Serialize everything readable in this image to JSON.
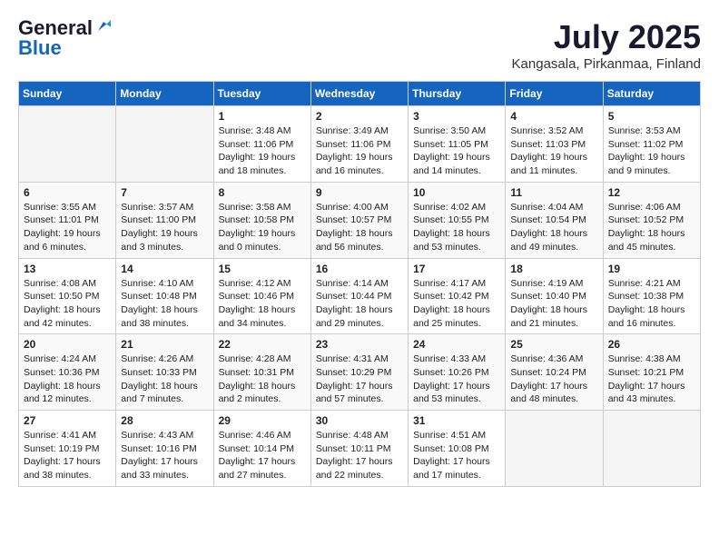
{
  "header": {
    "logo_general": "General",
    "logo_blue": "Blue",
    "month_year": "July 2025",
    "location": "Kangasala, Pirkanmaa, Finland"
  },
  "days_of_week": [
    "Sunday",
    "Monday",
    "Tuesday",
    "Wednesday",
    "Thursday",
    "Friday",
    "Saturday"
  ],
  "weeks": [
    [
      {
        "day": "",
        "info": ""
      },
      {
        "day": "",
        "info": ""
      },
      {
        "day": "1",
        "info": "Sunrise: 3:48 AM\nSunset: 11:06 PM\nDaylight: 19 hours\nand 18 minutes."
      },
      {
        "day": "2",
        "info": "Sunrise: 3:49 AM\nSunset: 11:06 PM\nDaylight: 19 hours\nand 16 minutes."
      },
      {
        "day": "3",
        "info": "Sunrise: 3:50 AM\nSunset: 11:05 PM\nDaylight: 19 hours\nand 14 minutes."
      },
      {
        "day": "4",
        "info": "Sunrise: 3:52 AM\nSunset: 11:03 PM\nDaylight: 19 hours\nand 11 minutes."
      },
      {
        "day": "5",
        "info": "Sunrise: 3:53 AM\nSunset: 11:02 PM\nDaylight: 19 hours\nand 9 minutes."
      }
    ],
    [
      {
        "day": "6",
        "info": "Sunrise: 3:55 AM\nSunset: 11:01 PM\nDaylight: 19 hours\nand 6 minutes."
      },
      {
        "day": "7",
        "info": "Sunrise: 3:57 AM\nSunset: 11:00 PM\nDaylight: 19 hours\nand 3 minutes."
      },
      {
        "day": "8",
        "info": "Sunrise: 3:58 AM\nSunset: 10:58 PM\nDaylight: 19 hours\nand 0 minutes."
      },
      {
        "day": "9",
        "info": "Sunrise: 4:00 AM\nSunset: 10:57 PM\nDaylight: 18 hours\nand 56 minutes."
      },
      {
        "day": "10",
        "info": "Sunrise: 4:02 AM\nSunset: 10:55 PM\nDaylight: 18 hours\nand 53 minutes."
      },
      {
        "day": "11",
        "info": "Sunrise: 4:04 AM\nSunset: 10:54 PM\nDaylight: 18 hours\nand 49 minutes."
      },
      {
        "day": "12",
        "info": "Sunrise: 4:06 AM\nSunset: 10:52 PM\nDaylight: 18 hours\nand 45 minutes."
      }
    ],
    [
      {
        "day": "13",
        "info": "Sunrise: 4:08 AM\nSunset: 10:50 PM\nDaylight: 18 hours\nand 42 minutes."
      },
      {
        "day": "14",
        "info": "Sunrise: 4:10 AM\nSunset: 10:48 PM\nDaylight: 18 hours\nand 38 minutes."
      },
      {
        "day": "15",
        "info": "Sunrise: 4:12 AM\nSunset: 10:46 PM\nDaylight: 18 hours\nand 34 minutes."
      },
      {
        "day": "16",
        "info": "Sunrise: 4:14 AM\nSunset: 10:44 PM\nDaylight: 18 hours\nand 29 minutes."
      },
      {
        "day": "17",
        "info": "Sunrise: 4:17 AM\nSunset: 10:42 PM\nDaylight: 18 hours\nand 25 minutes."
      },
      {
        "day": "18",
        "info": "Sunrise: 4:19 AM\nSunset: 10:40 PM\nDaylight: 18 hours\nand 21 minutes."
      },
      {
        "day": "19",
        "info": "Sunrise: 4:21 AM\nSunset: 10:38 PM\nDaylight: 18 hours\nand 16 minutes."
      }
    ],
    [
      {
        "day": "20",
        "info": "Sunrise: 4:24 AM\nSunset: 10:36 PM\nDaylight: 18 hours\nand 12 minutes."
      },
      {
        "day": "21",
        "info": "Sunrise: 4:26 AM\nSunset: 10:33 PM\nDaylight: 18 hours\nand 7 minutes."
      },
      {
        "day": "22",
        "info": "Sunrise: 4:28 AM\nSunset: 10:31 PM\nDaylight: 18 hours\nand 2 minutes."
      },
      {
        "day": "23",
        "info": "Sunrise: 4:31 AM\nSunset: 10:29 PM\nDaylight: 17 hours\nand 57 minutes."
      },
      {
        "day": "24",
        "info": "Sunrise: 4:33 AM\nSunset: 10:26 PM\nDaylight: 17 hours\nand 53 minutes."
      },
      {
        "day": "25",
        "info": "Sunrise: 4:36 AM\nSunset: 10:24 PM\nDaylight: 17 hours\nand 48 minutes."
      },
      {
        "day": "26",
        "info": "Sunrise: 4:38 AM\nSunset: 10:21 PM\nDaylight: 17 hours\nand 43 minutes."
      }
    ],
    [
      {
        "day": "27",
        "info": "Sunrise: 4:41 AM\nSunset: 10:19 PM\nDaylight: 17 hours\nand 38 minutes."
      },
      {
        "day": "28",
        "info": "Sunrise: 4:43 AM\nSunset: 10:16 PM\nDaylight: 17 hours\nand 33 minutes."
      },
      {
        "day": "29",
        "info": "Sunrise: 4:46 AM\nSunset: 10:14 PM\nDaylight: 17 hours\nand 27 minutes."
      },
      {
        "day": "30",
        "info": "Sunrise: 4:48 AM\nSunset: 10:11 PM\nDaylight: 17 hours\nand 22 minutes."
      },
      {
        "day": "31",
        "info": "Sunrise: 4:51 AM\nSunset: 10:08 PM\nDaylight: 17 hours\nand 17 minutes."
      },
      {
        "day": "",
        "info": ""
      },
      {
        "day": "",
        "info": ""
      }
    ]
  ]
}
